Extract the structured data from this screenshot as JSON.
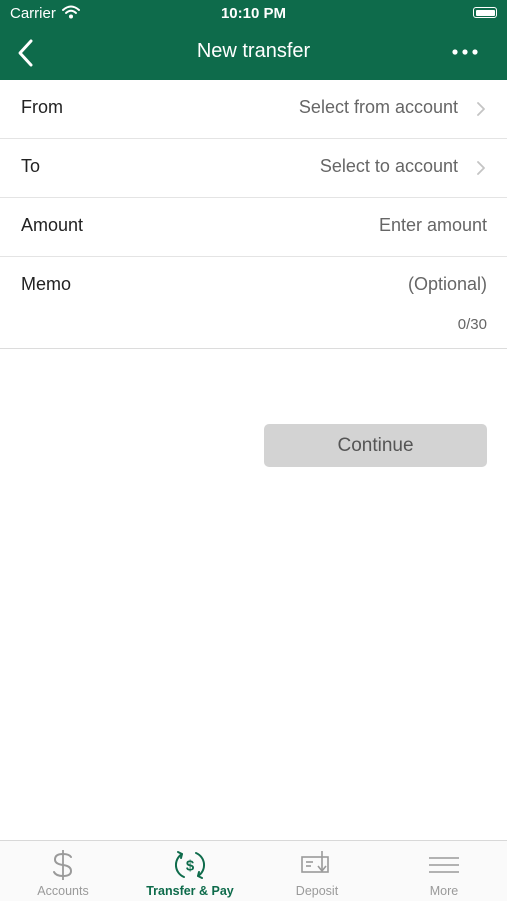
{
  "status_bar": {
    "carrier": "Carrier",
    "time": "10:10 PM"
  },
  "nav": {
    "title": "New transfer"
  },
  "form": {
    "from": {
      "label": "From",
      "value": "Select from account"
    },
    "to": {
      "label": "To",
      "value": "Select to account"
    },
    "amount": {
      "label": "Amount",
      "placeholder": "Enter amount"
    },
    "memo": {
      "label": "Memo",
      "placeholder": "(Optional)",
      "counter": "0/30"
    }
  },
  "continue_label": "Continue",
  "tabs": [
    {
      "label": "Accounts",
      "icon": "dollar-icon",
      "active": false
    },
    {
      "label": "Transfer & Pay",
      "icon": "transfer-icon",
      "active": true
    },
    {
      "label": "Deposit",
      "icon": "check-deposit-icon",
      "active": false
    },
    {
      "label": "More",
      "icon": "menu-icon",
      "active": false
    }
  ],
  "colors": {
    "brand": "#0e6b4b",
    "button_disabled": "#d3d3d3",
    "inactive_tab": "#9a9a9a"
  }
}
